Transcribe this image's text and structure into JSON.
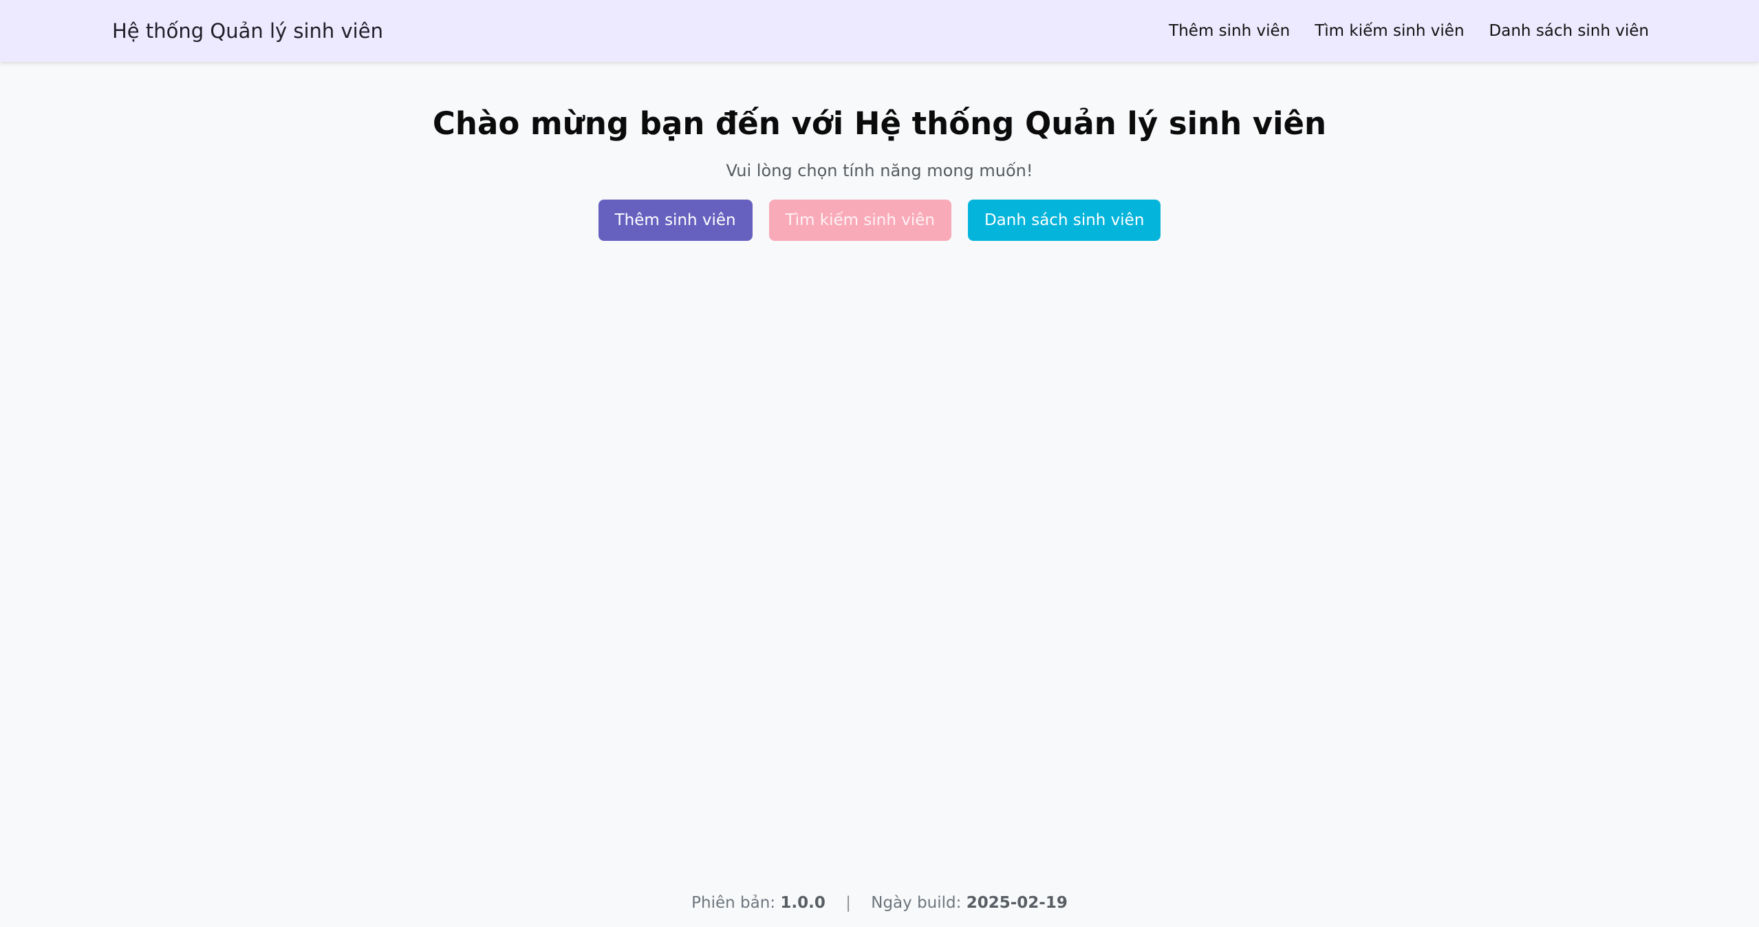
{
  "navbar": {
    "brand": "Hệ thống Quản lý sinh viên",
    "links": [
      {
        "label": "Thêm sinh viên"
      },
      {
        "label": "Tìm kiếm sinh viên"
      },
      {
        "label": "Danh sách sinh viên"
      }
    ],
    "background_color": "#ede9fe"
  },
  "hero": {
    "title": "Chào mừng bạn đến với Hệ thống Quản lý sinh viên",
    "subtitle": "Vui lòng chọn tính năng mong muốn!"
  },
  "actions": {
    "add_label": "Thêm sinh viên",
    "search_label": "Tìm kiếm sinh viên",
    "list_label": "Danh sách sinh viên",
    "colors": {
      "add": "#6661bf",
      "search": "#f9aab8",
      "list": "#04b4db"
    }
  },
  "footer": {
    "version_label": "Phiên bản:",
    "version_value": "1.0.0",
    "separator": "|",
    "build_label": "Ngày build:",
    "build_value": "2025-02-19"
  }
}
